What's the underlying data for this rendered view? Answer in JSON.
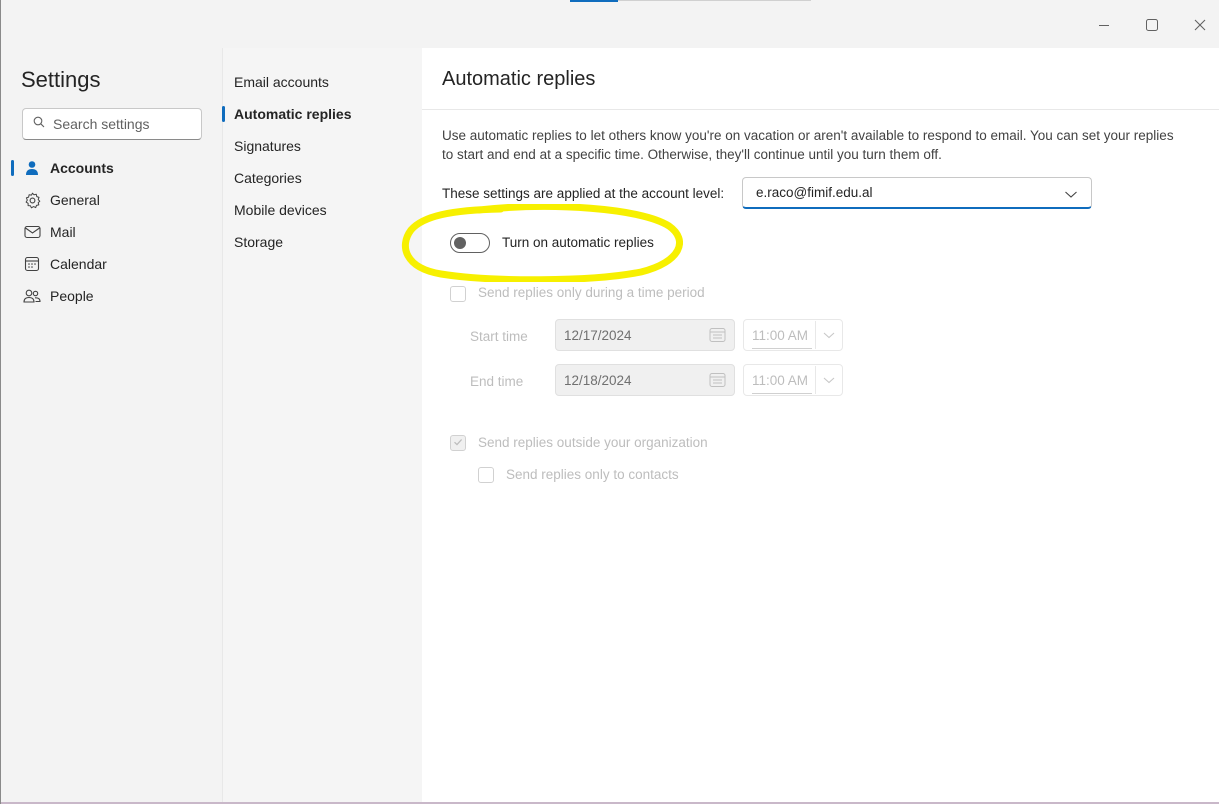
{
  "window": {
    "minimize_icon": "minimize-icon",
    "maximize_icon": "maximize-icon",
    "close_icon": "close-icon"
  },
  "settings": {
    "title": "Settings",
    "search_placeholder": "Search settings",
    "nav": [
      {
        "label": "Accounts",
        "icon": "person-icon",
        "active": true
      },
      {
        "label": "General",
        "icon": "gear-icon",
        "active": false
      },
      {
        "label": "Mail",
        "icon": "mail-icon",
        "active": false
      },
      {
        "label": "Calendar",
        "icon": "calendar-icon",
        "active": false
      },
      {
        "label": "People",
        "icon": "people-icon",
        "active": false
      }
    ]
  },
  "accounts_nav": {
    "items": [
      {
        "label": "Email accounts",
        "active": false
      },
      {
        "label": "Automatic replies",
        "active": true
      },
      {
        "label": "Signatures",
        "active": false
      },
      {
        "label": "Categories",
        "active": false
      },
      {
        "label": "Mobile devices",
        "active": false
      },
      {
        "label": "Storage",
        "active": false
      }
    ]
  },
  "content": {
    "title": "Automatic replies",
    "description": "Use automatic replies to let others know you're on vacation or aren't available to respond to email. You can set your replies to start and end at a specific time. Otherwise, they'll continue until you turn them off.",
    "account_label": "These settings are applied at the account level:",
    "account_value": "e.raco@fimif.edu.al",
    "toggle_label": "Turn on automatic replies",
    "toggle_on": false,
    "time_period_label": "Send replies only during a time period",
    "time_period_checked": false,
    "start_label": "Start time",
    "start_date": "12/17/2024",
    "start_time": "11:00 AM",
    "end_label": "End time",
    "end_date": "12/18/2024",
    "end_time": "11:00 AM",
    "outside_org_label": "Send replies outside your organization",
    "outside_org_checked": true,
    "contacts_only_label": "Send replies only to contacts",
    "contacts_only_checked": false
  },
  "colors": {
    "accent": "#0f6cbd",
    "highlight": "#f7f000"
  }
}
